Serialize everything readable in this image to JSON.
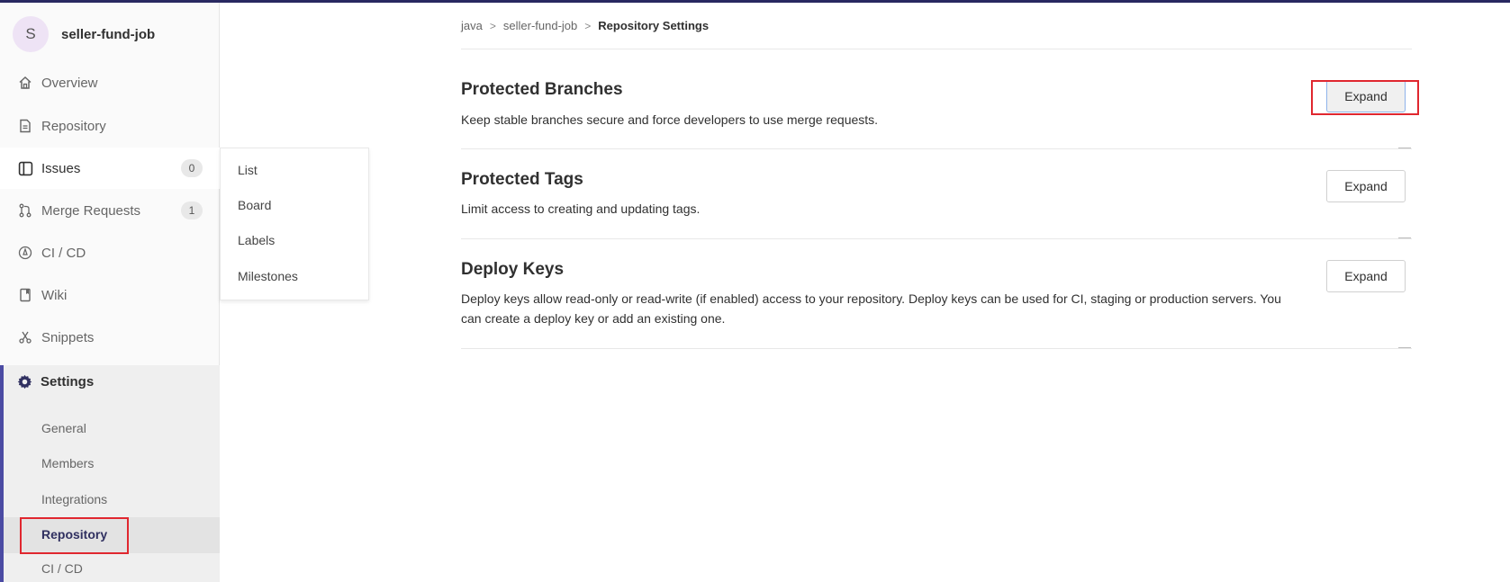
{
  "project": {
    "avatar_letter": "S",
    "name": "seller-fund-job"
  },
  "sidebar": {
    "items": [
      {
        "label": "Overview",
        "icon": "home-icon"
      },
      {
        "label": "Repository",
        "icon": "doc-icon"
      },
      {
        "label": "Issues",
        "icon": "issues-icon",
        "badge": "0"
      },
      {
        "label": "Merge Requests",
        "icon": "merge-request-icon",
        "badge": "1"
      },
      {
        "label": "CI / CD",
        "icon": "rocket-icon"
      },
      {
        "label": "Wiki",
        "icon": "book-icon"
      },
      {
        "label": "Snippets",
        "icon": "scissors-icon"
      }
    ],
    "settings": {
      "label": "Settings",
      "icon": "gear-icon",
      "sub_items": [
        "General",
        "Members",
        "Integrations",
        "Repository",
        "CI / CD"
      ],
      "active": "Repository"
    }
  },
  "flyout": {
    "items": [
      "List",
      "Board",
      "Labels",
      "Milestones"
    ]
  },
  "breadcrumb": {
    "items": [
      "java",
      "seller-fund-job"
    ],
    "current": "Repository Settings"
  },
  "sections": [
    {
      "title": "Protected Branches",
      "desc": "Keep stable branches secure and force developers to use merge requests.",
      "button": "Expand"
    },
    {
      "title": "Protected Tags",
      "desc": "Limit access to creating and updating tags.",
      "button": "Expand"
    },
    {
      "title": "Deploy Keys",
      "desc": "Deploy keys allow read-only or read-write (if enabled) access to your repository. Deploy keys can be used for CI, staging or production servers. You can create a deploy key or add an existing one.",
      "button": "Expand"
    }
  ],
  "colors": {
    "accent": "#4b4ba3",
    "highlight": "#e0272f",
    "topbar": "#292961"
  }
}
